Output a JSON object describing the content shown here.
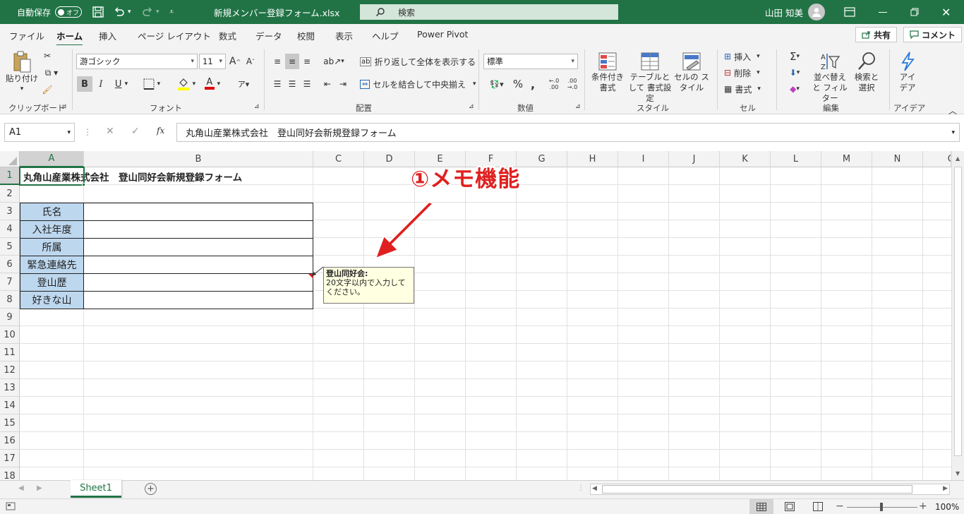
{
  "titlebar": {
    "autosave_label": "自動保存",
    "autosave_state": "オフ",
    "filename": "新規メンバー登録フォーム.xlsx",
    "search_placeholder": "検索",
    "user_name": "山田 知美"
  },
  "ribbon_tabs": [
    "ファイル",
    "ホーム",
    "挿入",
    "ページ レイアウト",
    "数式",
    "データ",
    "校閲",
    "表示",
    "ヘルプ",
    "Power Pivot"
  ],
  "share_label": "共有",
  "comment_label": "コメント",
  "ribbon": {
    "paste_label": "貼り付け",
    "clipboard_label": "クリップボード",
    "font_name": "游ゴシック",
    "font_size": "11",
    "font_label": "フォント",
    "wrap_label": "折り返して全体を表示する",
    "merge_label": "セルを結合して中央揃え",
    "alignment_label": "配置",
    "number_format": "標準",
    "number_label": "数値",
    "cond_format_label": "条件付き 書式",
    "table_format_label": "テーブルとして 書式設定",
    "cell_style_label": "セルの スタイル",
    "styles_label": "スタイル",
    "insert_label": "挿入",
    "delete_label": "削除",
    "format_label": "書式",
    "cells_label": "セル",
    "sort_filter_label": "並べ替えと フィルター",
    "find_select_label": "検索と 選択",
    "editing_label": "編集",
    "ideas_label": "アイ デア",
    "ideas_group_label": "アイデア"
  },
  "formula_bar": {
    "name_box": "A1",
    "content": "丸角山産業株式会社　登山同好会新規登録フォーム"
  },
  "columns": [
    "A",
    "B",
    "C",
    "D",
    "E",
    "F",
    "G",
    "H",
    "I",
    "J",
    "K",
    "L",
    "M",
    "N",
    "O"
  ],
  "rows": [
    "1",
    "2",
    "3",
    "4",
    "5",
    "6",
    "7",
    "8",
    "9",
    "10",
    "11",
    "12",
    "13",
    "14",
    "15",
    "16",
    "17",
    "18"
  ],
  "sheet": {
    "title": "丸角山産業株式会社　登山同好会新規登録フォーム",
    "labels": [
      "氏名",
      "入社年度",
      "所属",
      "緊急連絡先",
      "登山歴",
      "好きな山"
    ]
  },
  "memo": {
    "author": "登山同好会:",
    "text_line1": "20文字以内で入力して",
    "text_line2": "ください。"
  },
  "annotation": "①メモ機能",
  "sheet_tab": "Sheet1",
  "zoom": "100%"
}
